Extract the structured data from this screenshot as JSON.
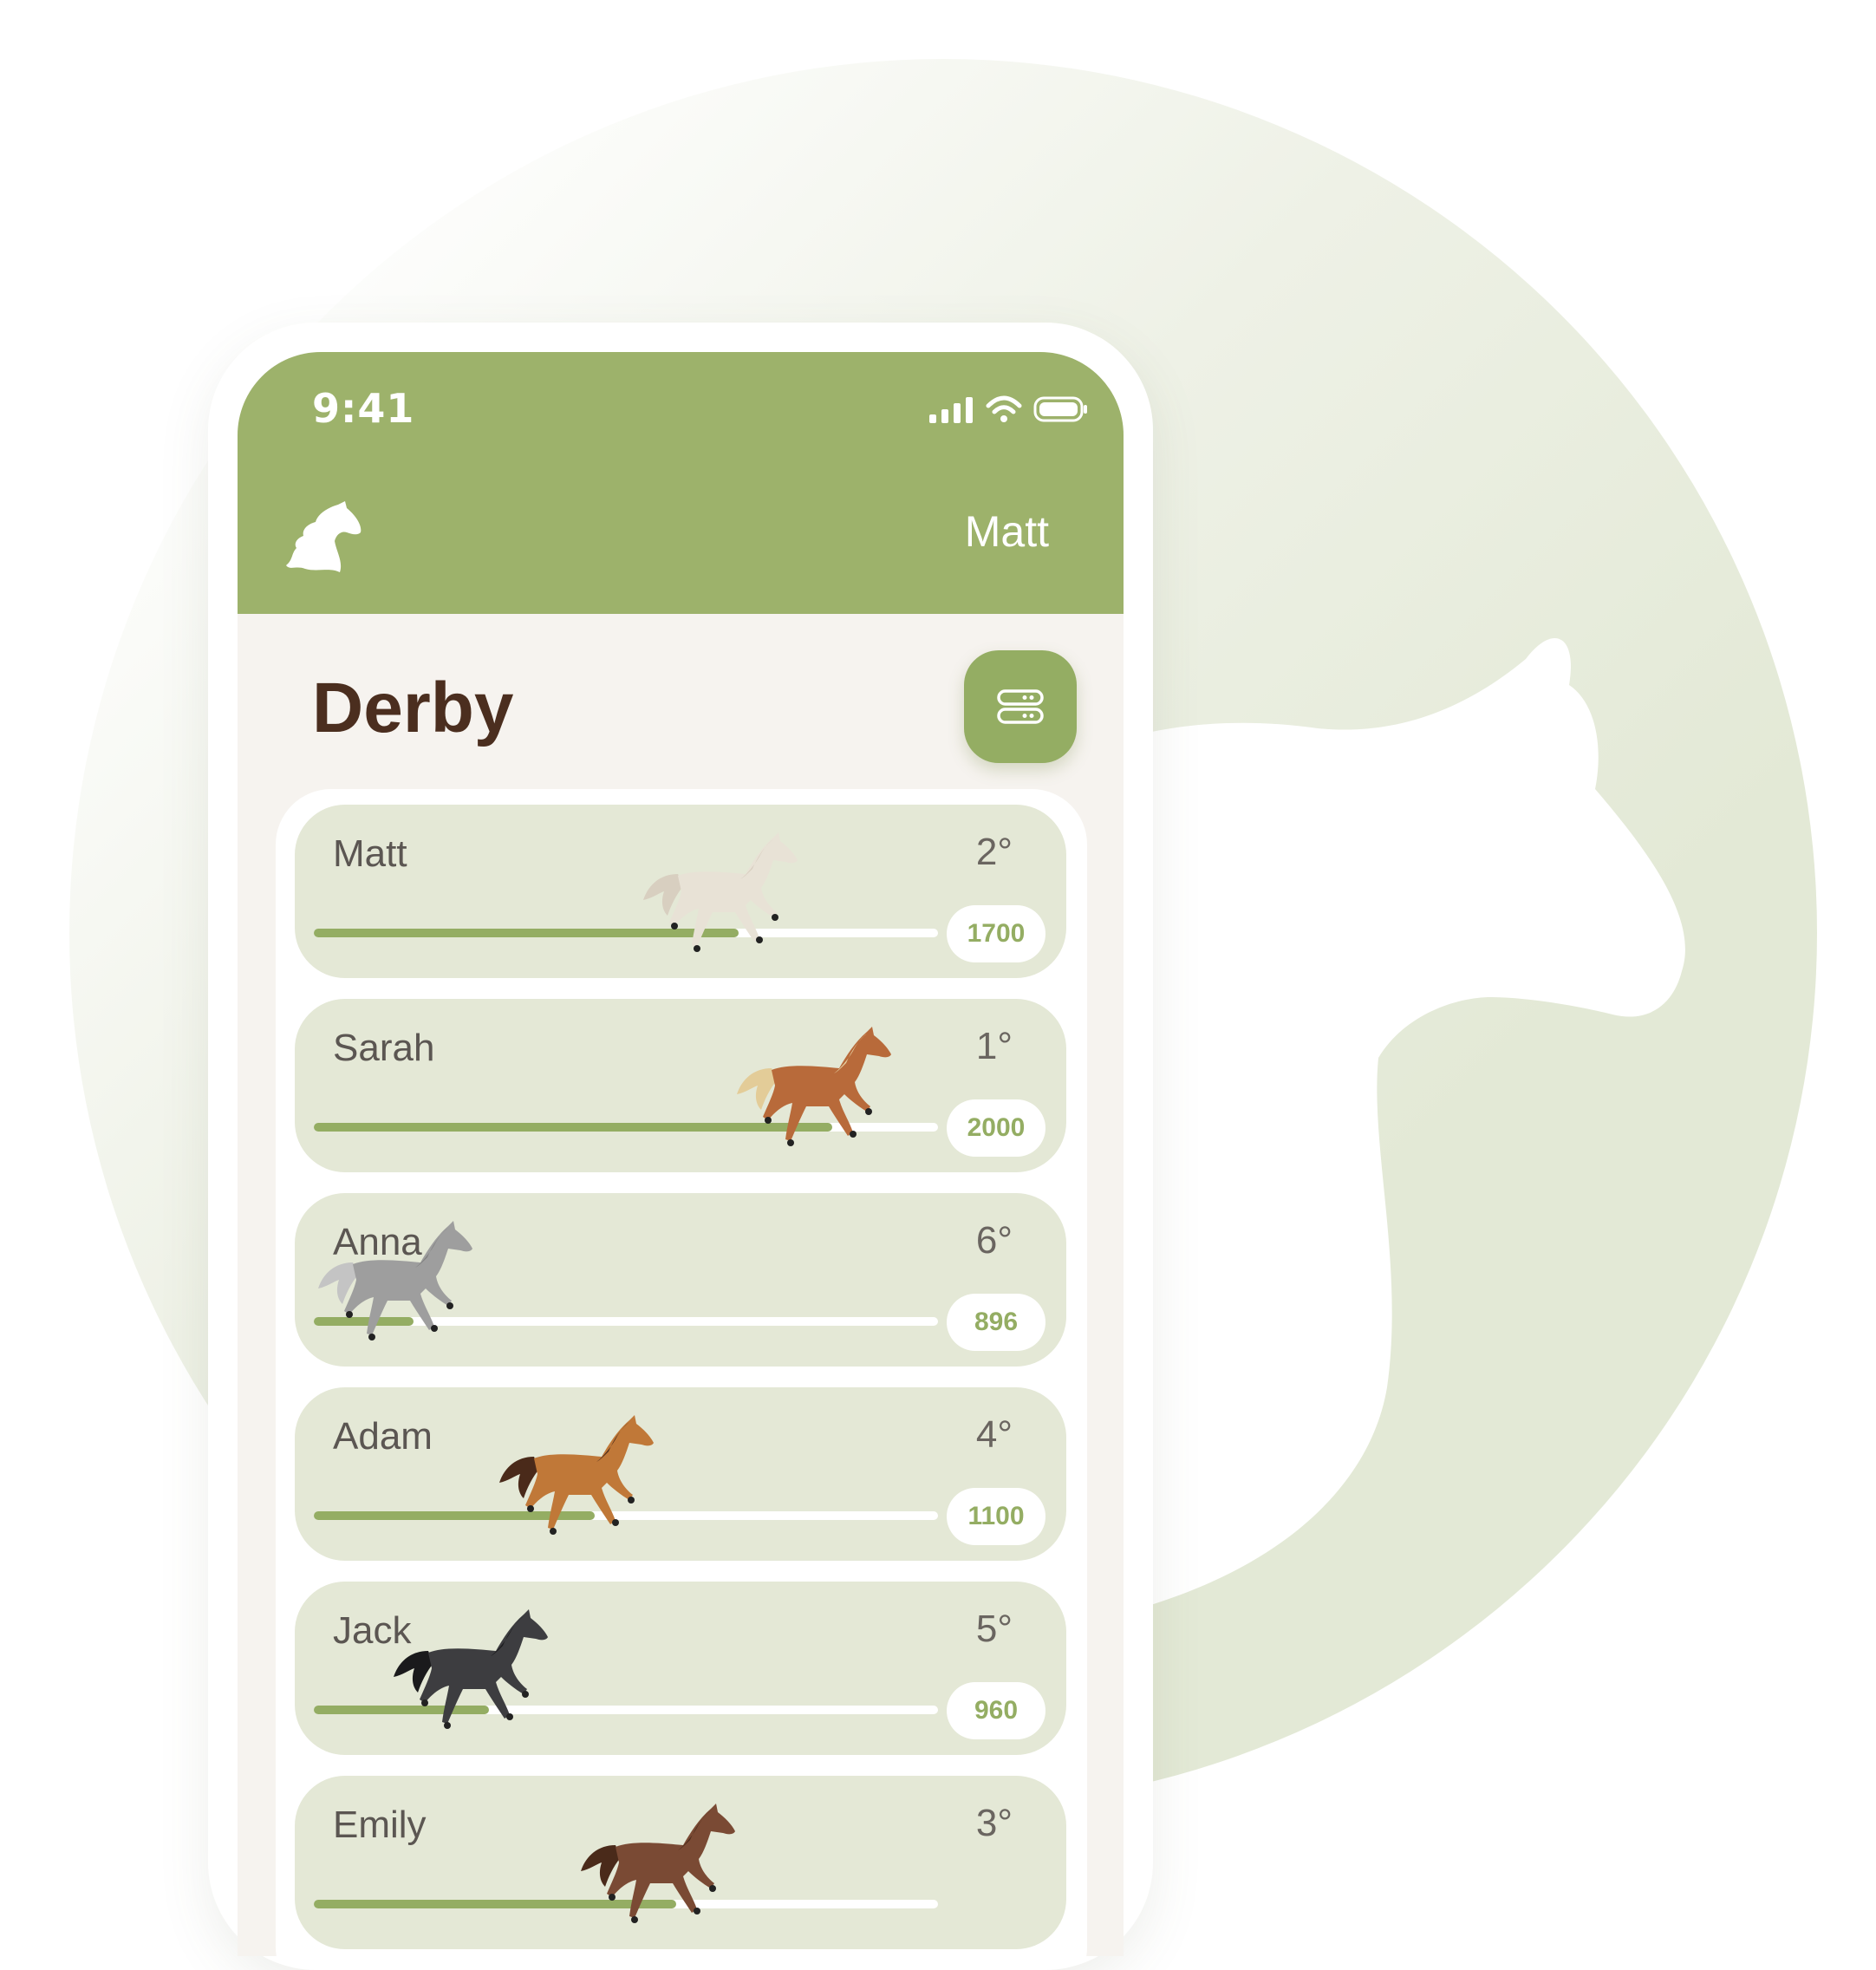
{
  "status_bar": {
    "time": "9:41"
  },
  "header": {
    "user_name": "Matt",
    "logo_icon": "horse-head-logo-icon"
  },
  "page": {
    "title": "Derby",
    "settings_icon": "toggles-icon"
  },
  "colors": {
    "accent": "#9db26b",
    "card": "#e4e8d6",
    "title": "#4b2e1f",
    "background": "#f6f3ef"
  },
  "racers": [
    {
      "name": "Matt",
      "rank": "2°",
      "score": "1700",
      "progress": 0.68,
      "horse": "white-horse-icon"
    },
    {
      "name": "Sarah",
      "rank": "1°",
      "score": "2000",
      "progress": 0.83,
      "horse": "pinto-horse-icon"
    },
    {
      "name": "Anna",
      "rank": "6°",
      "score": "896",
      "progress": 0.16,
      "horse": "dapple-gray-horse-icon"
    },
    {
      "name": "Adam",
      "rank": "4°",
      "score": "1100",
      "progress": 0.45,
      "horse": "bay-horse-icon"
    },
    {
      "name": "Jack",
      "rank": "5°",
      "score": "960",
      "progress": 0.28,
      "horse": "black-horse-icon"
    },
    {
      "name": "Emily",
      "rank": "3°",
      "score": "",
      "progress": 0.58,
      "horse": "paint-horse-icon"
    }
  ]
}
